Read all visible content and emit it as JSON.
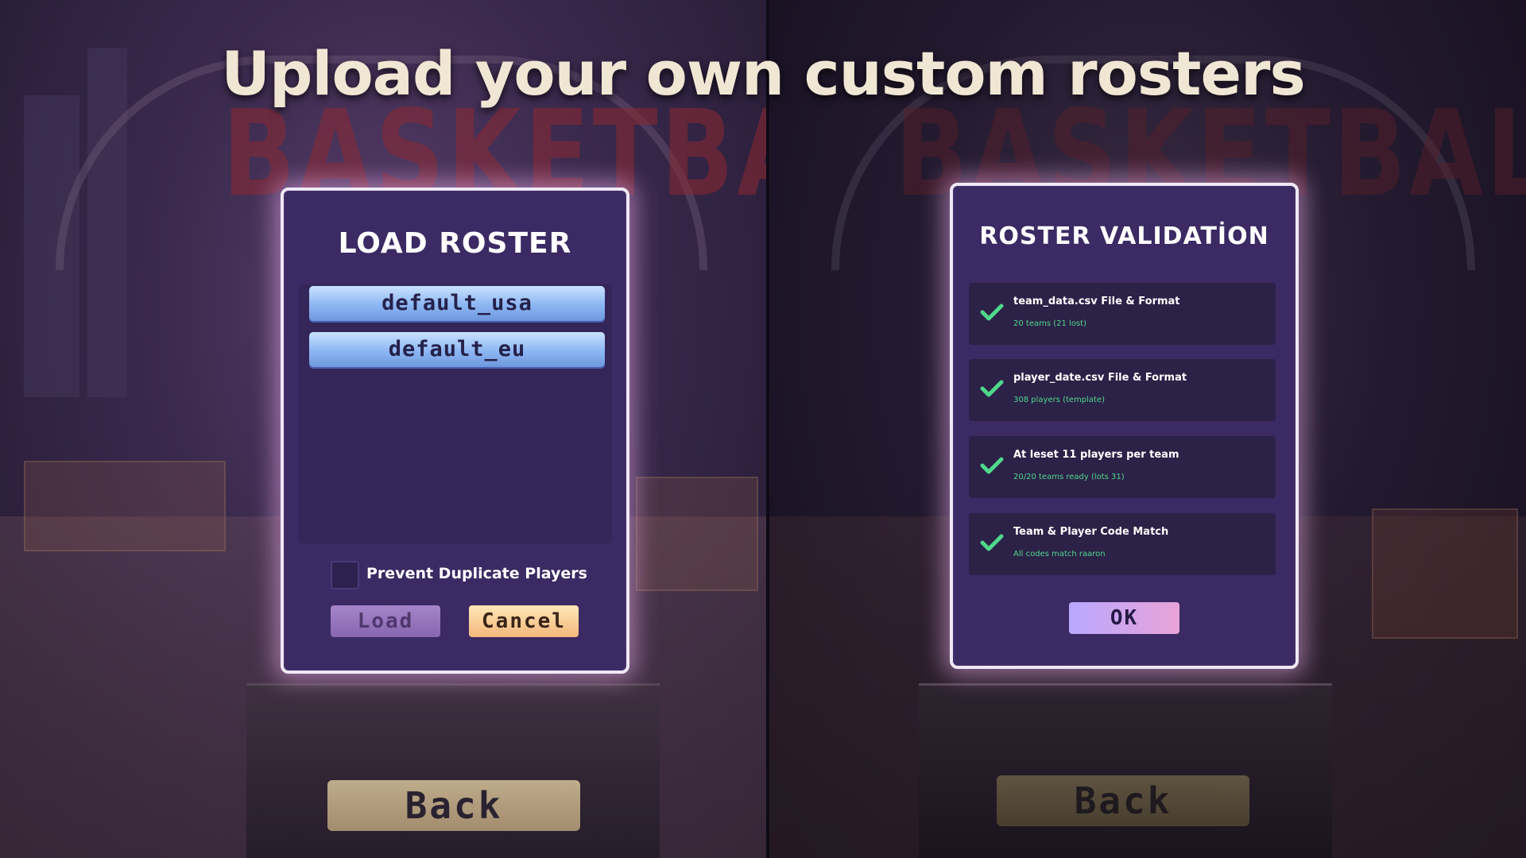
{
  "headline": "Upload your own custom rosters",
  "background_text": "BASKETBALL",
  "load_roster": {
    "title": "LOAD ROSTER",
    "rosters": [
      "default_usa",
      "default_eu"
    ],
    "prevent_duplicates_label": "Prevent Duplicate Players",
    "prevent_duplicates_checked": false,
    "load_label": "Load",
    "cancel_label": "Cancel",
    "back_label": "Back"
  },
  "roster_validation": {
    "title": "ROSTER VALIDATİON",
    "checks": [
      {
        "title": "team_data.csv File & Format",
        "detail": "20 teams (21 lost)",
        "passed": true
      },
      {
        "title": "player_date.csv File & Format",
        "detail": "308 players (template)",
        "passed": true
      },
      {
        "title": "At leset 11 players per team",
        "detail": "20/20 teams ready (lots 31)",
        "passed": true
      },
      {
        "title": "Team & Player Code Match",
        "detail": "All codes match raaron",
        "passed": true
      }
    ],
    "ok_label": "OK",
    "back_label": "Back"
  },
  "colors": {
    "accent_check": "#4fd88b",
    "panel": "#3b2a63",
    "glow": "#e6aae6"
  }
}
